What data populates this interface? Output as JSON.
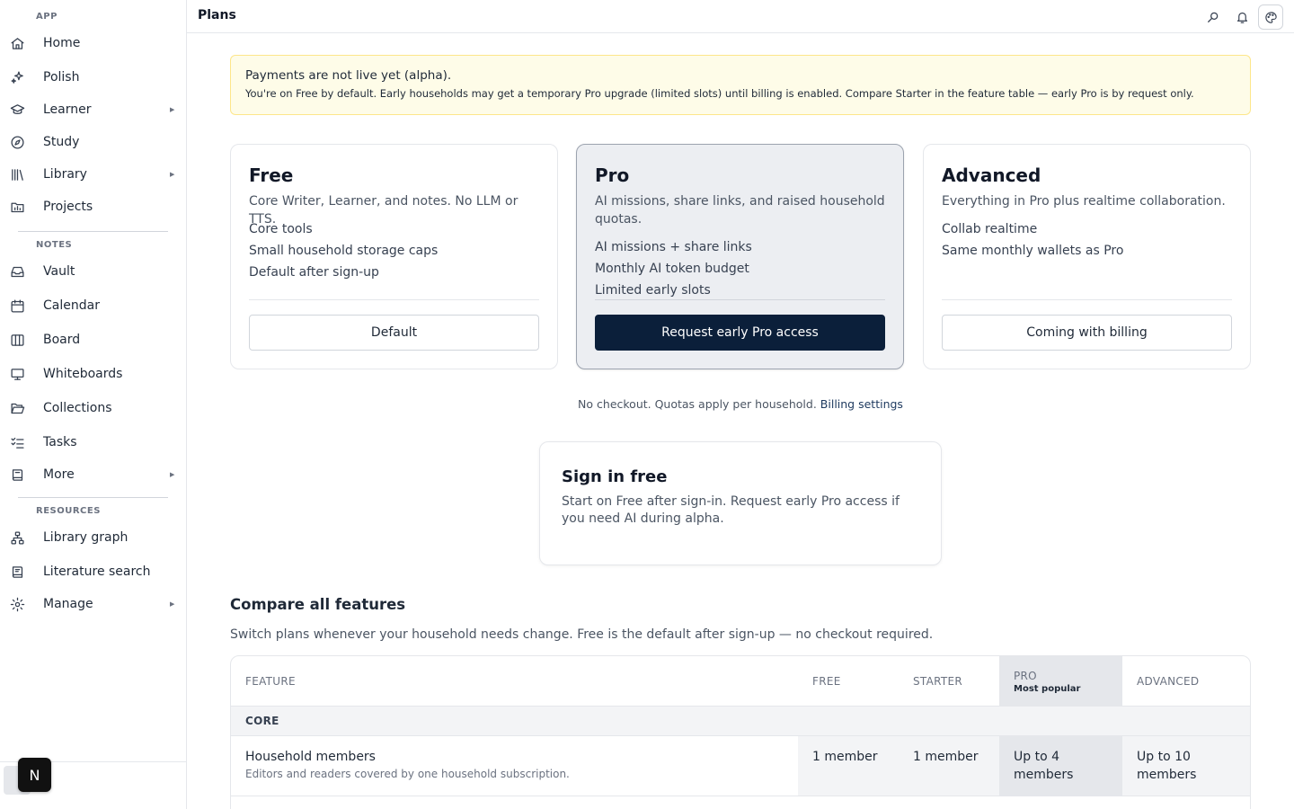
{
  "sidebar": {
    "sections": {
      "app": "APP",
      "notes": "NOTES",
      "resources": "RESOURCES"
    },
    "items": {
      "home": "Home",
      "polish": "Polish",
      "learner": "Learner",
      "study": "Study",
      "library": "Library",
      "projects": "Projects",
      "vault": "Vault",
      "calendar": "Calendar",
      "board": "Board",
      "whiteboards": "Whiteboards",
      "collections": "Collections",
      "tasks": "Tasks",
      "more": "More",
      "library_graph": "Library graph",
      "literature_search": "Literature search",
      "manage": "Manage"
    },
    "badge": "N"
  },
  "header": {
    "title": "Plans"
  },
  "banner": {
    "title": "Payments are not live yet (alpha).",
    "text": "You're on Free by default. Early households may get a temporary Pro upgrade (limited slots) until billing is enabled. Compare Starter in the feature table — early Pro is by request only."
  },
  "plans": {
    "free": {
      "name": "Free",
      "desc": "Core Writer, Learner, and notes. No LLM or TTS.",
      "features": [
        "Core tools",
        "Small household storage caps",
        "Default after sign-up"
      ],
      "button": "Default"
    },
    "pro": {
      "name": "Pro",
      "desc": "AI missions, share links, and raised household quotas.",
      "features": [
        "AI missions + share links",
        "Monthly AI token budget",
        "Limited early slots"
      ],
      "button": "Request early Pro access"
    },
    "advanced": {
      "name": "Advanced",
      "desc": "Everything in Pro plus realtime collaboration.",
      "features": [
        "Collab realtime",
        "Same monthly wallets as Pro"
      ],
      "button": "Coming with billing"
    }
  },
  "checkout": {
    "note": "No checkout. Quotas apply per household.",
    "link": "Billing settings"
  },
  "signin": {
    "title": "Sign in free",
    "text": "Start on Free after sign-in. Request early Pro access if you need AI during alpha."
  },
  "compare": {
    "title": "Compare all features",
    "subtitle": "Switch plans whenever your household needs change. Free is the default after sign-up — no checkout required.",
    "headers": {
      "feature": "FEATURE",
      "free": "FREE",
      "starter": "STARTER",
      "pro": "PRO",
      "pro_sub": "Most popular",
      "advanced": "ADVANCED"
    },
    "group": "CORE",
    "rows": [
      {
        "feature": "Household members",
        "desc": "Editors and readers covered by one household subscription.",
        "free": "1 member",
        "starter": "1 member",
        "pro": "Up to 4 members",
        "advanced": "Up to 10 members"
      }
    ]
  },
  "colors": {
    "banner_bg": "#fefce8",
    "primary_button": "#0b1f3a",
    "pro_column": "#e5e7eb"
  }
}
